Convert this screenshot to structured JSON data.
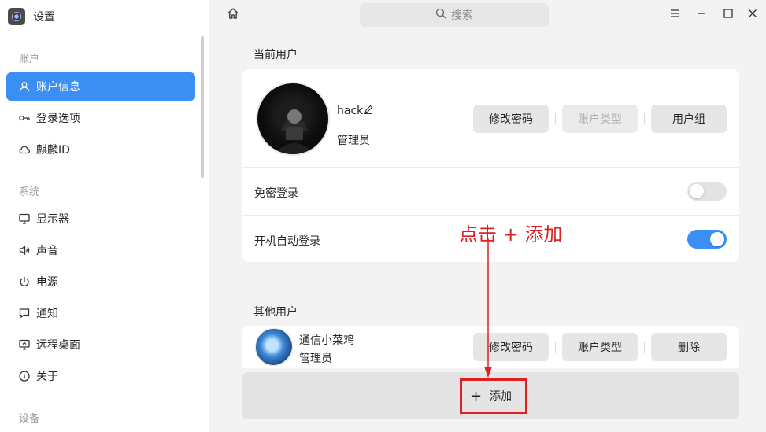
{
  "app": {
    "title": "设置"
  },
  "sidebar": {
    "sections": [
      {
        "label": "账户",
        "items": [
          {
            "label": "账户信息",
            "icon": "user-icon",
            "active": true
          },
          {
            "label": "登录选项",
            "icon": "key-icon",
            "active": false
          },
          {
            "label": "麒麟ID",
            "icon": "cloud-icon",
            "active": false
          }
        ]
      },
      {
        "label": "系统",
        "items": [
          {
            "label": "显示器",
            "icon": "monitor-icon",
            "active": false
          },
          {
            "label": "声音",
            "icon": "speaker-icon",
            "active": false
          },
          {
            "label": "电源",
            "icon": "power-icon",
            "active": false
          },
          {
            "label": "通知",
            "icon": "chat-bubble-icon",
            "active": false
          },
          {
            "label": "远程桌面",
            "icon": "remote-desktop-icon",
            "active": false
          },
          {
            "label": "关于",
            "icon": "info-icon",
            "active": false
          }
        ]
      },
      {
        "label": "设备",
        "items": []
      }
    ]
  },
  "titlebar": {
    "search_placeholder": "搜索"
  },
  "current_user": {
    "group_title": "当前用户",
    "name": "hack",
    "role": "管理员",
    "buttons": {
      "change_password": "修改密码",
      "account_type": "账户类型",
      "user_group": "用户组"
    },
    "auto_login_free": {
      "label": "免密登录",
      "enabled": false
    },
    "auto_login_boot": {
      "label": "开机自动登录",
      "enabled": true
    }
  },
  "other_users": {
    "group_title": "其他用户",
    "users": [
      {
        "name": "通信小菜鸡",
        "role": "管理员",
        "buttons": {
          "change_password": "修改密码",
          "account_type": "账户类型",
          "delete": "删除"
        }
      }
    ],
    "add_label": "添加"
  },
  "annotation": {
    "text": "点击 + 添加",
    "color": "#e01f1f"
  },
  "colors": {
    "accent": "#3c8ff2",
    "annotation": "#e01f1f"
  }
}
